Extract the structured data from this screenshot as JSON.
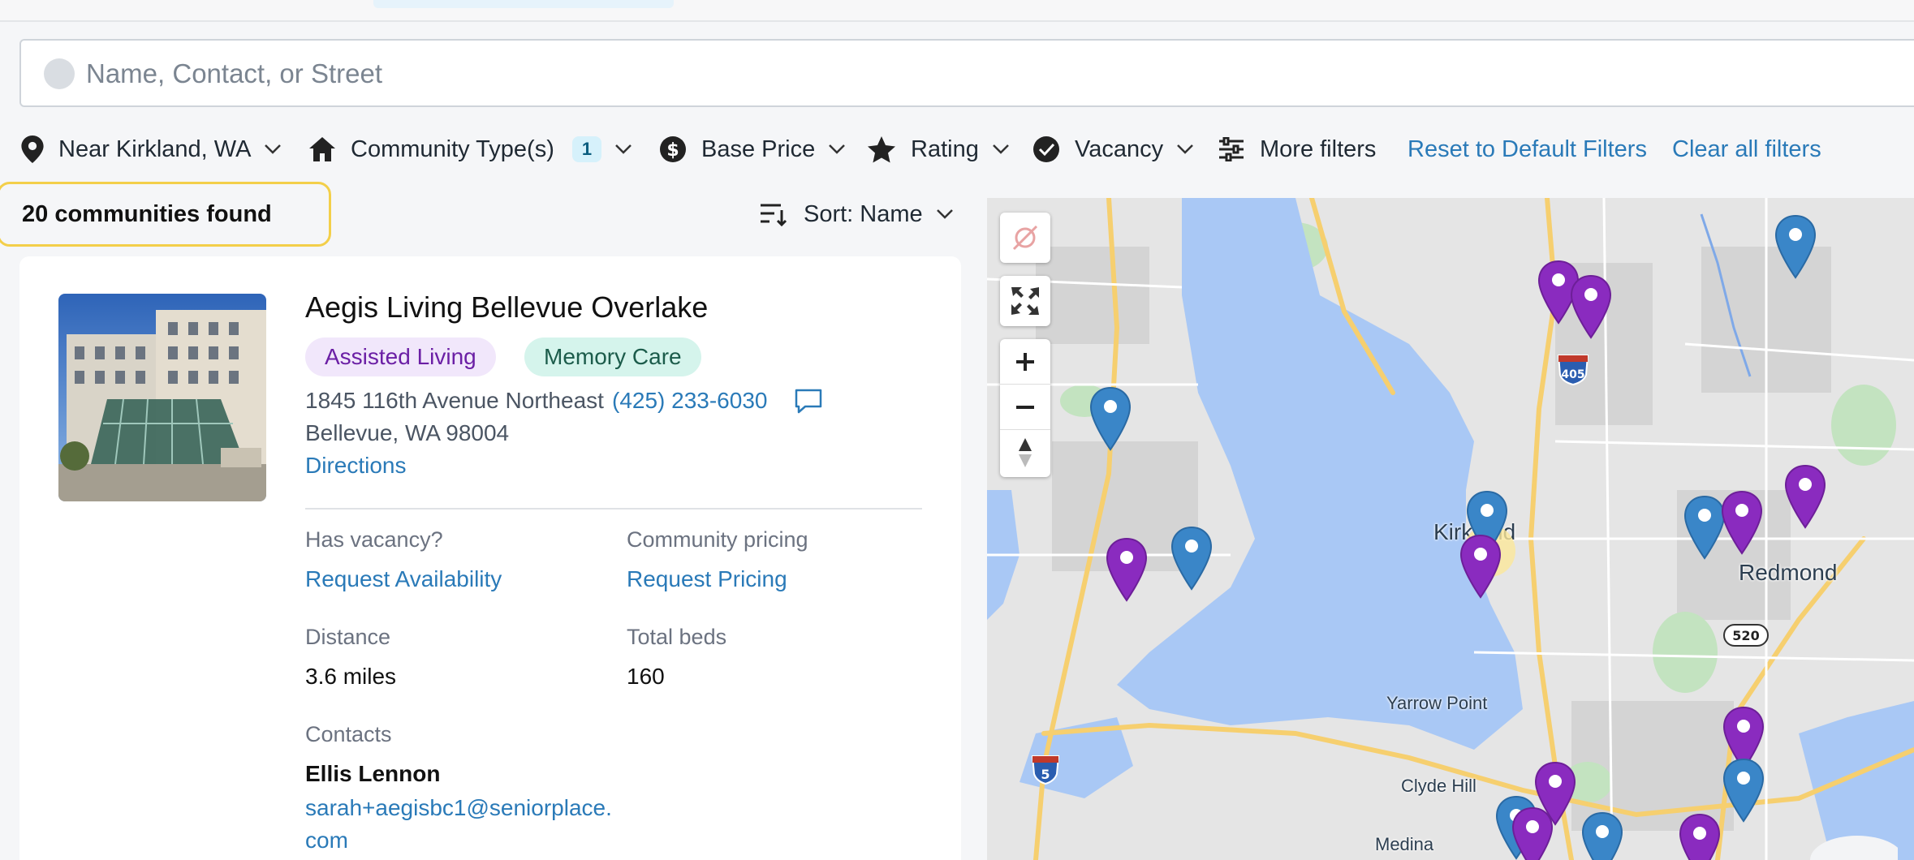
{
  "search": {
    "placeholder": "Name, Contact, or Street"
  },
  "filters": {
    "location": "Near Kirkland, WA",
    "community_type": "Community Type(s)",
    "community_type_count": "1",
    "base_price": "Base Price",
    "rating": "Rating",
    "vacancy": "Vacancy",
    "more_filters": "More filters",
    "reset": "Reset to Default Filters",
    "clear": "Clear all filters"
  },
  "results": {
    "count_label": "20 communities found",
    "sort_label": "Sort: Name"
  },
  "community": {
    "name": "Aegis Living Bellevue Overlake",
    "tags": [
      "Assisted Living",
      "Memory Care"
    ],
    "address_line1": "1845 116th Avenue Northeast",
    "address_line2": "Bellevue, WA 98004",
    "phone": "(425) 233-6030",
    "directions": "Directions",
    "vacancy_label": "Has vacancy?",
    "vacancy_link": "Request Availability",
    "pricing_label": "Community pricing",
    "pricing_link": "Request Pricing",
    "distance_label": "Distance",
    "distance_value": "3.6 miles",
    "beds_label": "Total beds",
    "beds_value": "160",
    "contacts_label": "Contacts",
    "contact_name": "Ellis Lennon",
    "contact_email": "sarah+aegisbc1@seniorplace.com"
  },
  "map": {
    "labels": {
      "kirkland": "Kirkland",
      "redmond": "Redmond",
      "yarrow_point": "Yarrow Point",
      "clyde_hill": "Clyde Hill",
      "medina": "Medina"
    },
    "shields": {
      "i405": "405",
      "i5": "5",
      "sr520": "520"
    },
    "colors": {
      "purple_pin": "#8a2bbf",
      "blue_pin": "#3a86c8",
      "water": "#a9c8f5"
    }
  }
}
